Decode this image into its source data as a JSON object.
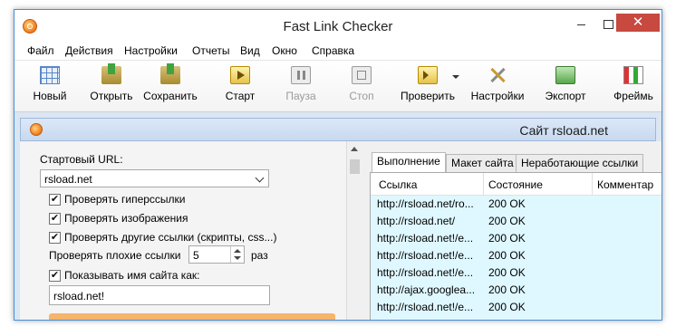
{
  "window": {
    "title": "Fast Link Checker"
  },
  "window_controls": {
    "minimize": "",
    "maximize": "",
    "close": "✕"
  },
  "menu": [
    "Файл",
    "Действия",
    "Настройки",
    "Отчеты",
    "Вид",
    "Окно",
    "Справка"
  ],
  "toolbar": [
    {
      "label": "Новый",
      "icon": "new-grid-icon",
      "enabled": true
    },
    {
      "label": "Открыть",
      "icon": "open-folder-icon",
      "enabled": true
    },
    {
      "label": "Сохранить",
      "icon": "save-folder-icon",
      "enabled": true
    },
    {
      "label": "Старт",
      "icon": "play-icon",
      "enabled": true
    },
    {
      "label": "Пауза",
      "icon": "pause-icon",
      "enabled": false
    },
    {
      "label": "Стоп",
      "icon": "stop-icon",
      "enabled": false
    },
    {
      "label": "Проверить",
      "icon": "check-dropdown-icon",
      "enabled": true
    },
    {
      "label": "Настройки",
      "icon": "tools-icon",
      "enabled": true
    },
    {
      "label": "Экспорт",
      "icon": "export-icon",
      "enabled": true
    },
    {
      "label": "Фреймь",
      "icon": "frames-icon",
      "enabled": true
    }
  ],
  "document": {
    "title": "Сайт rsload.net"
  },
  "settings": {
    "start_url_label": "Стартовый URL:",
    "start_url_value": "rsload.net",
    "check_hyperlinks": {
      "label": "Проверять гиперссылки",
      "checked": true
    },
    "check_images": {
      "label": "Проверять изображения",
      "checked": true
    },
    "check_other": {
      "label": "Проверять другие ссылки (скрипты, css...)",
      "checked": true
    },
    "bad_links_label": "Проверять плохие ссылки",
    "bad_links_value": "5",
    "bad_links_unit": "раз",
    "show_site_name": {
      "label": "Показывать имя сайта как:",
      "checked": true
    },
    "site_name_value": "rsload.net!"
  },
  "tabs": [
    "Выполнение",
    "Макет сайта",
    "Неработающие ссылки"
  ],
  "table": {
    "columns": [
      "Ссылка",
      "Состояние",
      "Комментар"
    ],
    "rows": [
      {
        "link": "http://rsload.net/ro...",
        "status": "200 OK",
        "comment": ""
      },
      {
        "link": "http://rsload.net/",
        "status": "200 OK",
        "comment": ""
      },
      {
        "link": "http://rsload.net!/e...",
        "status": "200 OK",
        "comment": ""
      },
      {
        "link": "http://rsload.net!/e...",
        "status": "200 OK",
        "comment": ""
      },
      {
        "link": "http://rsload.net!/e...",
        "status": "200 OK",
        "comment": ""
      },
      {
        "link": "http://ajax.googlea...",
        "status": "200 OK",
        "comment": ""
      },
      {
        "link": "http://rsload.net!/e...",
        "status": "200 OK",
        "comment": ""
      }
    ]
  }
}
